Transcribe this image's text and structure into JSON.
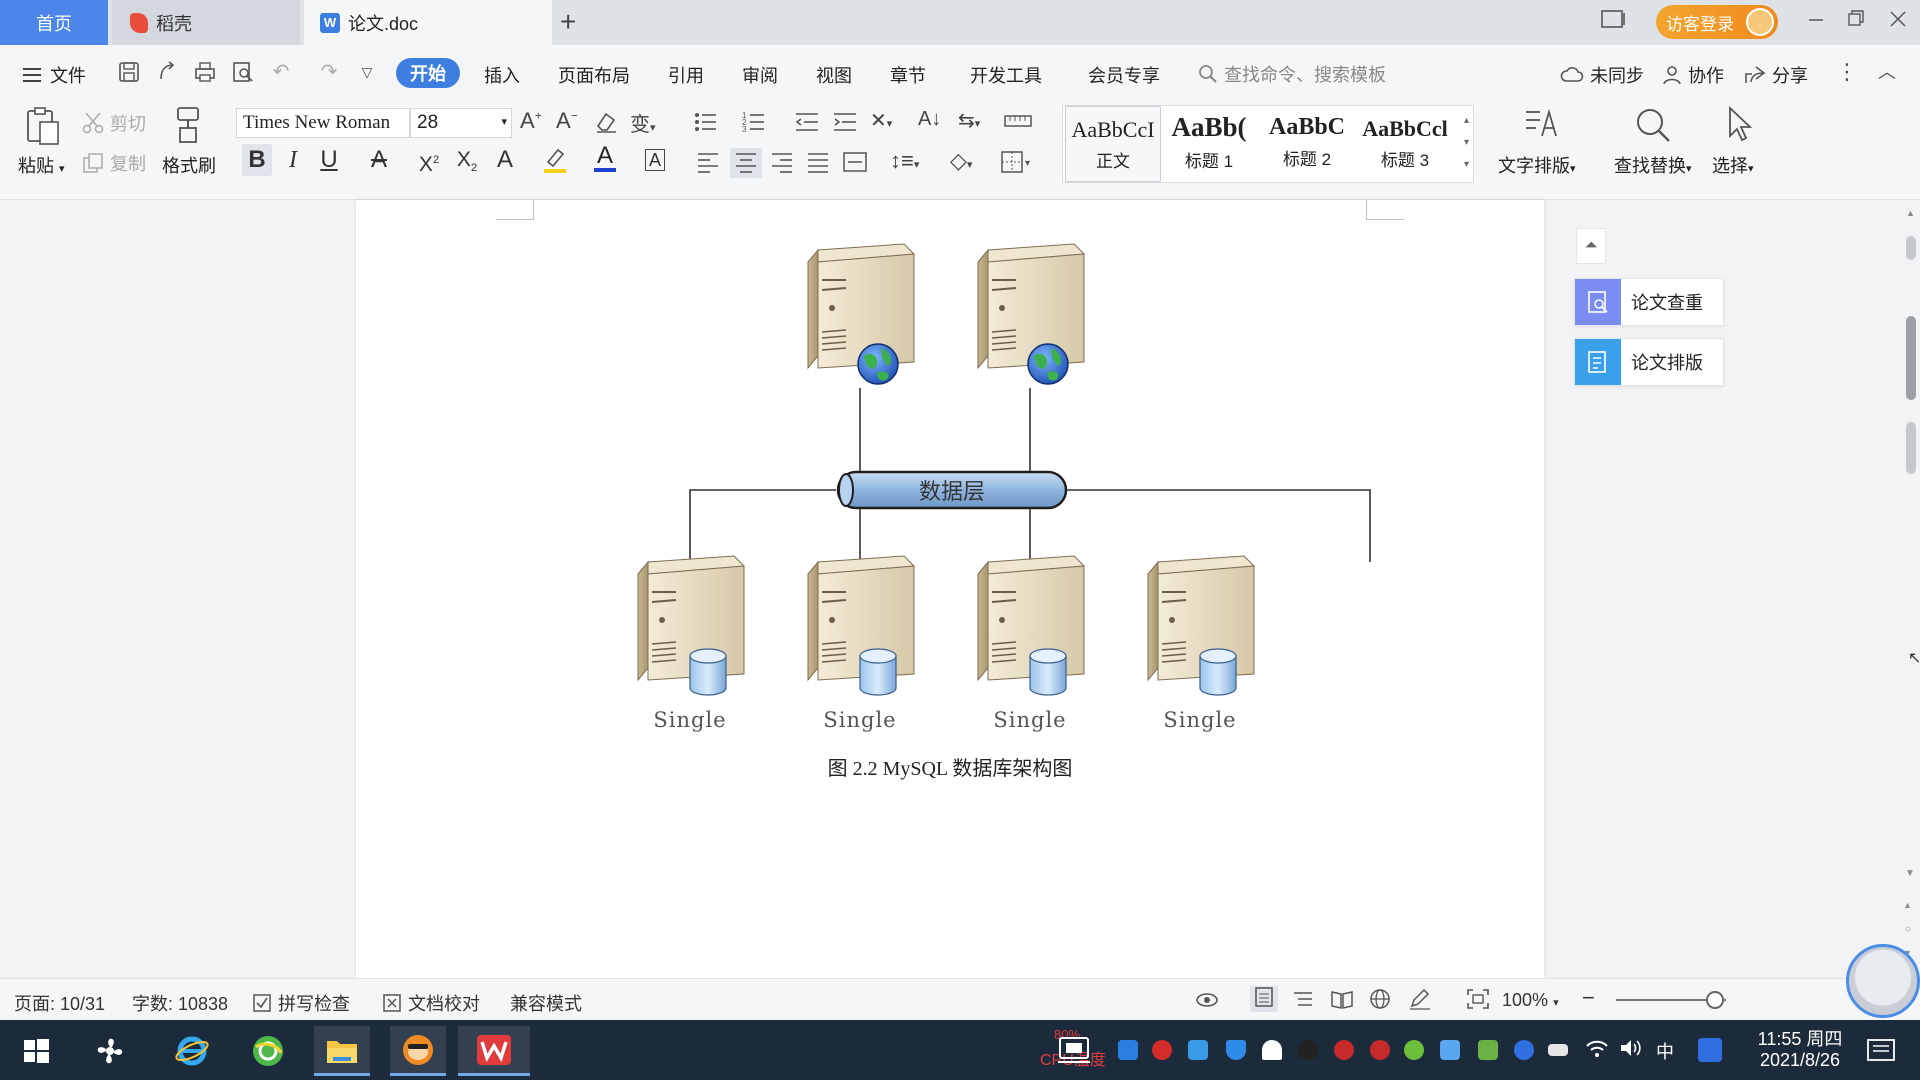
{
  "tabs": {
    "home": "首页",
    "daoke": "稻壳",
    "doc": "论文.doc",
    "add": "+"
  },
  "title_bar": {
    "visitor_login": "访客登录"
  },
  "menu": {
    "file": "文件",
    "items": [
      "开始",
      "插入",
      "页面布局",
      "引用",
      "审阅",
      "视图",
      "章节",
      "开发工具",
      "会员专享"
    ],
    "search_placeholder": "查找命令、搜索模板",
    "not_synced": "未同步",
    "collaborate": "协作",
    "share": "分享"
  },
  "ribbon": {
    "paste": "粘贴",
    "cut": "剪切",
    "copy": "复制",
    "format_painter": "格式刷",
    "font_name": "Times New Roman",
    "font_size": "28",
    "styles": [
      {
        "sample": "AaBbCcI",
        "name": "正文"
      },
      {
        "sample": "AaBb(",
        "name": "标题 1"
      },
      {
        "sample": "AaBbC",
        "name": "标题 2"
      },
      {
        "sample": "AaBbCcl",
        "name": "标题 3"
      }
    ],
    "text_layout": "文字排版",
    "find_replace": "查找替换",
    "select": "选择"
  },
  "document": {
    "diagram": {
      "data_layer_label": "数据层",
      "node_label": "Single"
    },
    "caption": "图 2.2 MySQL 数据库架构图"
  },
  "side_panel": {
    "plagiarism_check": "论文查重",
    "thesis_format": "论文排版"
  },
  "status": {
    "page": "页面: 10/31",
    "word_count": "字数: 10838",
    "spell_check": "拼写检查",
    "doc_proofread": "文档校对",
    "compat_mode": "兼容模式",
    "zoom": "100%"
  },
  "taskbar": {
    "cpu_pct": "80%",
    "cpu_temp": "CPU温度",
    "ime": "中",
    "time": "11:55 周四",
    "date": "2021/8/26"
  },
  "colors": {
    "accent": "#3c7fe0",
    "tab_home": "#4b86e8",
    "visitor": "#f08a1c",
    "taskbar": "#1c2b3c"
  }
}
